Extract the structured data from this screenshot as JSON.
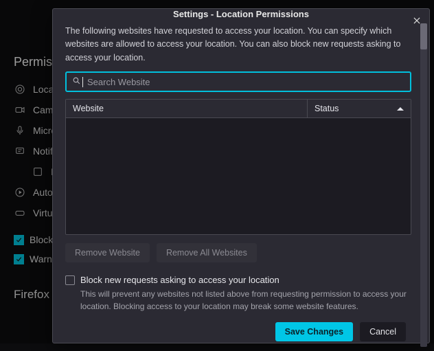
{
  "bg": {
    "heading": "Permissions",
    "items": {
      "location": "Location",
      "camera": "Camera",
      "microphone": "Microphone",
      "notifications": "Notifications",
      "pause": "Pause",
      "autoplay": "Autoplay",
      "virtual": "Virtual Reality"
    },
    "block_popups": "Block pop-up windows",
    "warn_addons": "Warn you when websites try to install add-ons",
    "footer": "Firefox Data Collection and Use"
  },
  "modal": {
    "title": "Settings - Location Permissions",
    "description": "The following websites have requested to access your location. You can specify which websites are allowed to access your location. You can also block new requests asking to access your location.",
    "search_placeholder": "Search Website",
    "col_website": "Website",
    "col_status": "Status",
    "remove_one": "Remove Website",
    "remove_all": "Remove All Websites",
    "block_label": "Block new requests asking to access your location",
    "block_desc": "This will prevent any websites not listed above from requesting permission to access your location. Blocking access to your location may break some website features.",
    "save": "Save Changes",
    "cancel": "Cancel"
  }
}
